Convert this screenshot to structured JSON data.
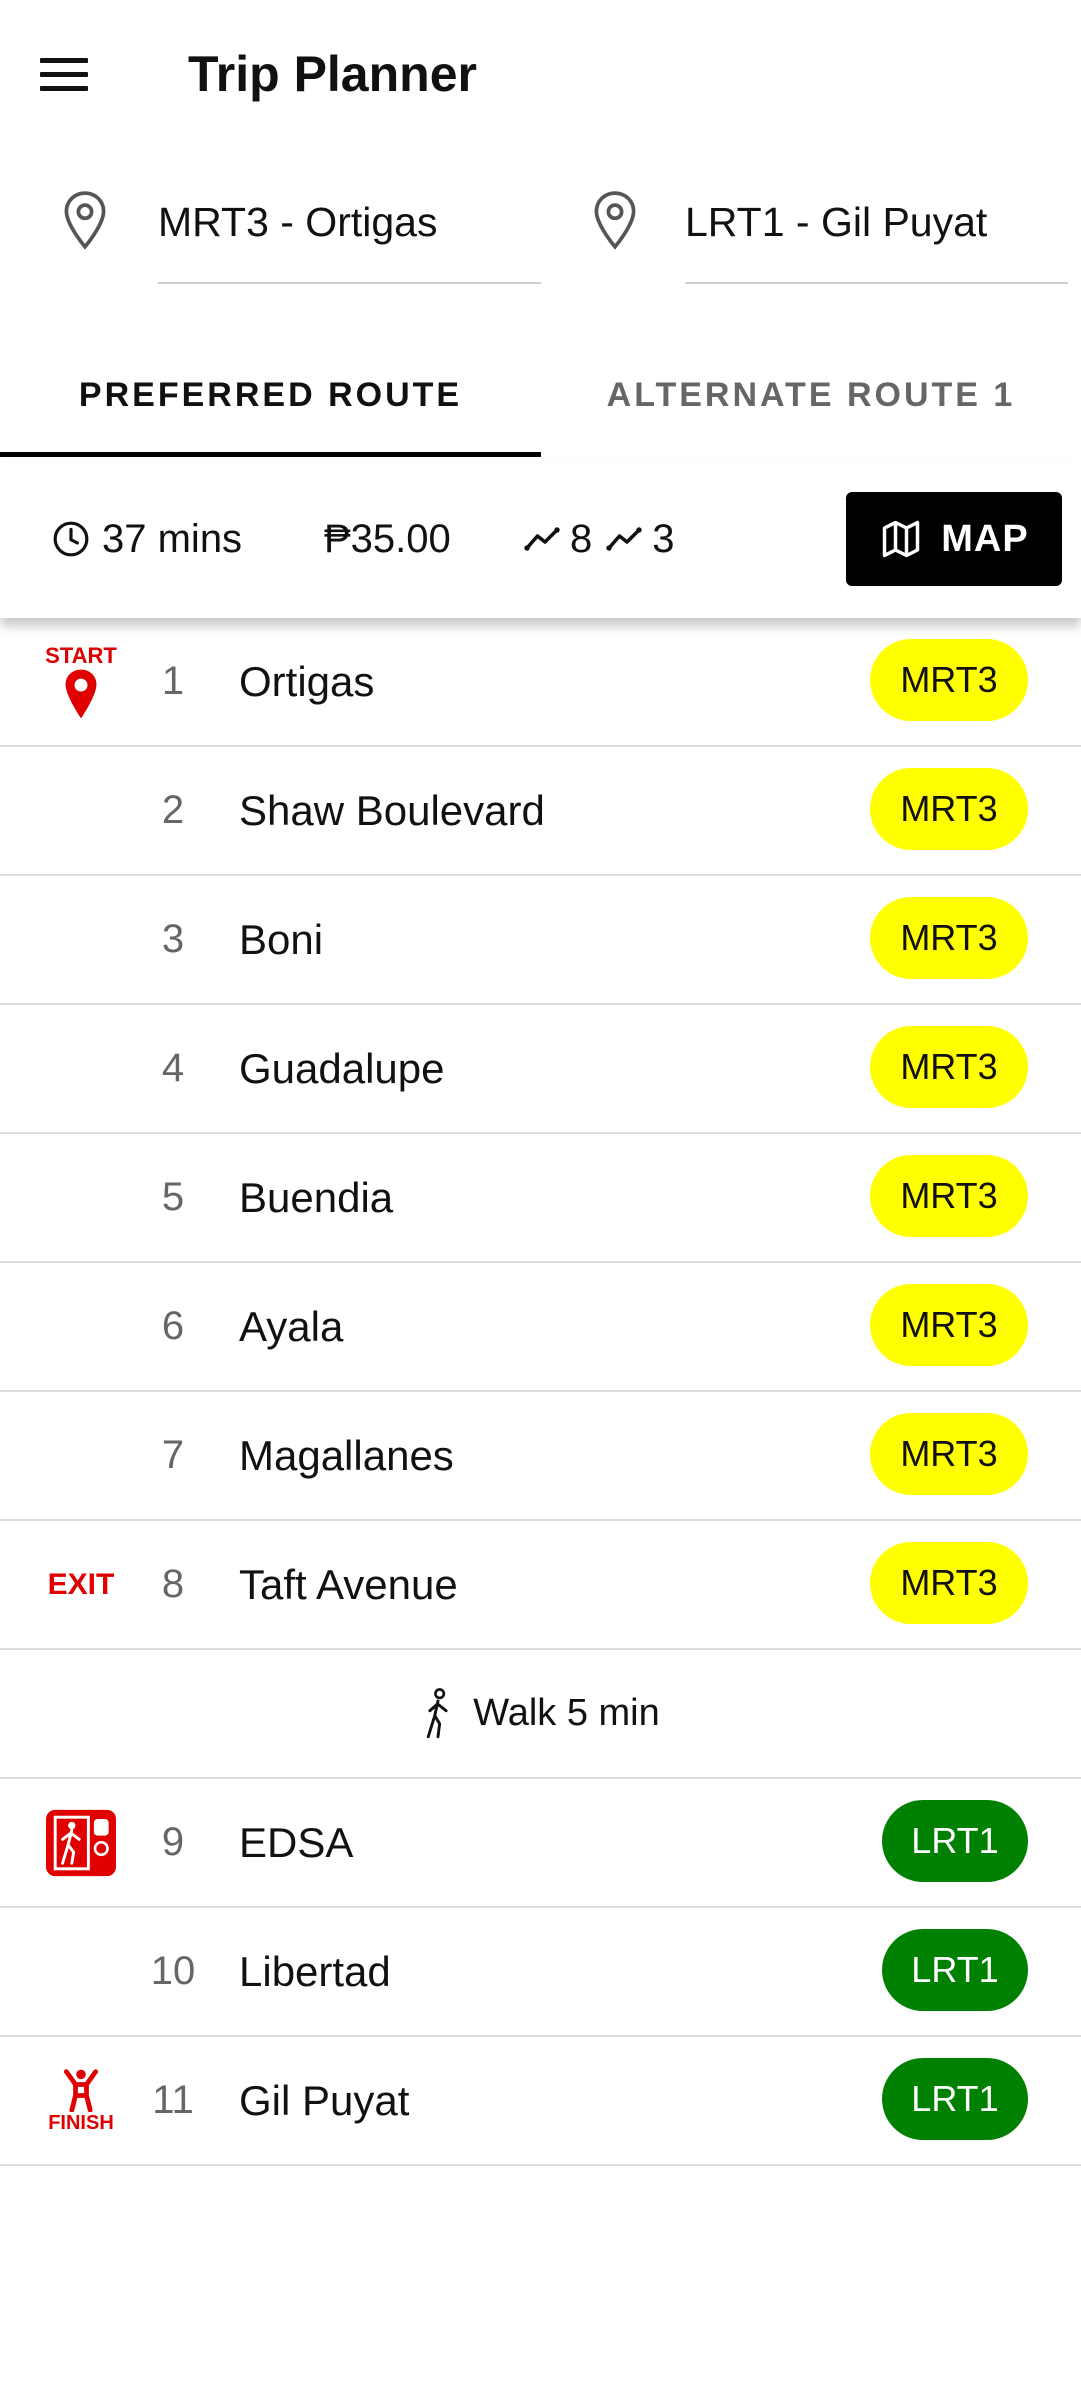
{
  "app": {
    "title": "Trip Planner"
  },
  "origin": {
    "value": "MRT3 - Ortigas"
  },
  "destination": {
    "value": "LRT1 - Gil Puyat"
  },
  "tabs": [
    {
      "label": "PREFERRED ROUTE",
      "active": true
    },
    {
      "label": "ALTERNATE ROUTE 1",
      "active": false
    }
  ],
  "summary": {
    "time": "37 mins",
    "fare": "₱35.00",
    "stops_a": "8",
    "stops_b": "3",
    "map_label": "MAP"
  },
  "markers": {
    "start": "START",
    "exit": "EXIT",
    "finish": "FINISH"
  },
  "walk": {
    "label": "Walk 5 min"
  },
  "stations": [
    {
      "num": "1",
      "name": "Ortigas",
      "line": "MRT3"
    },
    {
      "num": "2",
      "name": "Shaw Boulevard",
      "line": "MRT3"
    },
    {
      "num": "3",
      "name": "Boni",
      "line": "MRT3"
    },
    {
      "num": "4",
      "name": "Guadalupe",
      "line": "MRT3"
    },
    {
      "num": "5",
      "name": "Buendia",
      "line": "MRT3"
    },
    {
      "num": "6",
      "name": "Ayala",
      "line": "MRT3"
    },
    {
      "num": "7",
      "name": "Magallanes",
      "line": "MRT3"
    },
    {
      "num": "8",
      "name": "Taft Avenue",
      "line": "MRT3"
    },
    {
      "num": "9",
      "name": "EDSA",
      "line": "LRT1"
    },
    {
      "num": "10",
      "name": "Libertad",
      "line": "LRT1"
    },
    {
      "num": "11",
      "name": "Gil Puyat",
      "line": "LRT1"
    }
  ],
  "colors": {
    "mrt3": "#ffff00",
    "lrt1": "#008000",
    "marker_red": "#e00000"
  }
}
